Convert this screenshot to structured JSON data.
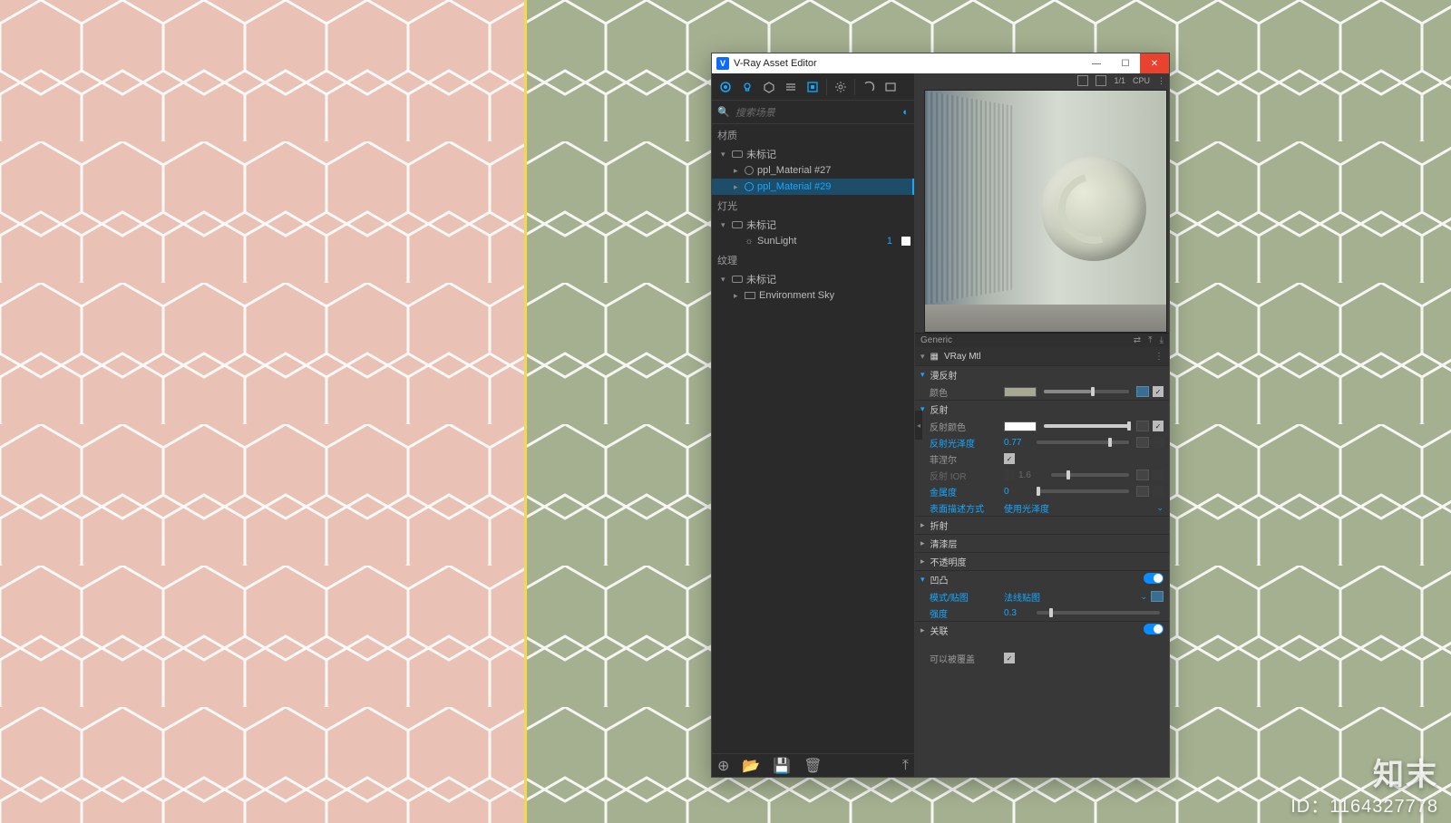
{
  "window": {
    "title": "V-Ray Asset Editor",
    "app_icon_letter": "V"
  },
  "search": {
    "placeholder": "搜索场景"
  },
  "tree": {
    "materials_header": "材质",
    "materials_group": "未标记",
    "material1": "ppl_Material #27",
    "material2": "ppl_Material #29",
    "lights_header": "灯光",
    "lights_group": "未标记",
    "sunlight": "SunLight",
    "sunlight_count": "1",
    "textures_header": "纹理",
    "textures_group": "未标记",
    "env_sky": "Environment Sky"
  },
  "preview_bar": {
    "ratio": "1/1",
    "mode": "CPU"
  },
  "material": {
    "type_label": "Generic",
    "name": "VRay Mtl"
  },
  "sections": {
    "diffuse": "漫反射",
    "reflection": "反射",
    "refraction": "折射",
    "coat": "清漆层",
    "opacity": "不透明度",
    "bump": "凹凸",
    "binding": "关联"
  },
  "props": {
    "color": "颜色",
    "reflect_color": "反射颜色",
    "reflect_gloss": "反射光泽度",
    "reflect_gloss_val": "0.77",
    "fresnel": "菲涅尔",
    "reflect_ior": "反射 IOR",
    "reflect_ior_val": "1.6",
    "metalness": "金属度",
    "metalness_val": "0",
    "surface_desc": "表面描述方式",
    "surface_desc_val": "使用光泽度",
    "bump_mode": "模式/贴图",
    "bump_mode_val": "法线贴图",
    "bump_strength": "强度",
    "bump_strength_val": "0.3",
    "overridable": "可以被覆盖"
  },
  "colors": {
    "diffuse_swatch": "#a6a893",
    "reflect_swatch": "#ffffff"
  },
  "watermark": {
    "logo": "知末",
    "id": "ID：1164327778"
  }
}
